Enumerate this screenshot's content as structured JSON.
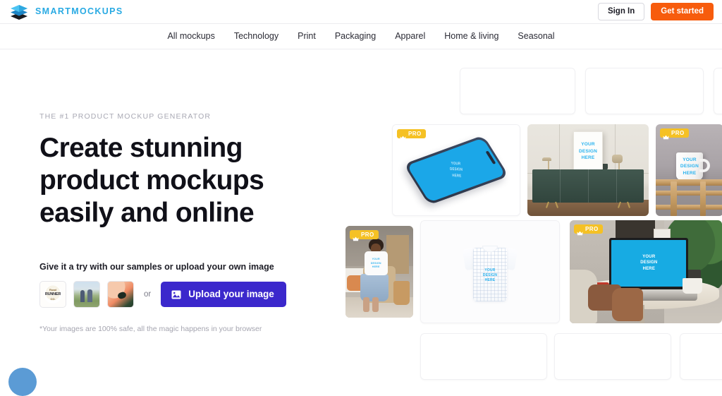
{
  "header": {
    "logo_icon": "layers-stack-icon",
    "brand_name": "SMARTMOCKUPS",
    "brand_color": "#29aae3",
    "sign_in_label": "Sign In",
    "get_started_label": "Get started",
    "get_started_color": "#f75c0d"
  },
  "nav": {
    "items": [
      {
        "label": "All mockups"
      },
      {
        "label": "Technology"
      },
      {
        "label": "Print"
      },
      {
        "label": "Packaging"
      },
      {
        "label": "Apparel"
      },
      {
        "label": "Home & living"
      },
      {
        "label": "Seasonal"
      }
    ]
  },
  "hero": {
    "eyebrow": "THE #1 PRODUCT MOCKUP GENERATOR",
    "headline": "Create stunning product mockups easily and online",
    "try_label": "Give it a try with our samples or upload your own image",
    "or_text": "or",
    "upload_label": "Upload your image",
    "upload_icon": "image-icon",
    "upload_color": "#3b28cc",
    "footnote": "*Your images are 100% safe, all the magic happens in your browser",
    "samples": [
      {
        "name": "sample-road-runner-logo",
        "alt_text_line1": "Road",
        "alt_text_line2": "RUNNER",
        "alt_text_line3": "CO."
      },
      {
        "name": "sample-people-outdoors"
      },
      {
        "name": "sample-abstract-art"
      }
    ]
  },
  "mockups": {
    "pro_badge_label": "PRO",
    "pro_badge_icon": "crown-icon",
    "pro_badge_color": "#f5c124",
    "design_placeholder": "YOUR\nDESIGN\nHERE",
    "cards": [
      {
        "name": "mockup-card-placeholder-top-1",
        "type": "placeholder",
        "pro": false
      },
      {
        "name": "mockup-card-placeholder-top-2",
        "type": "placeholder",
        "pro": false
      },
      {
        "name": "mockup-card-placeholder-top-3",
        "type": "placeholder",
        "pro": false
      },
      {
        "name": "mockup-card-phone",
        "type": "phone",
        "pro": true
      },
      {
        "name": "mockup-card-poster-sideboard",
        "type": "poster",
        "pro": false
      },
      {
        "name": "mockup-card-mug",
        "type": "mug",
        "pro": true
      },
      {
        "name": "mockup-card-person-tshirt",
        "type": "person",
        "pro": true
      },
      {
        "name": "mockup-card-flat-tshirt",
        "type": "tshirt",
        "pro": false
      },
      {
        "name": "mockup-card-laptop",
        "type": "laptop",
        "pro": true
      },
      {
        "name": "mockup-card-placeholder-bottom-1",
        "type": "placeholder",
        "pro": false
      },
      {
        "name": "mockup-card-placeholder-bottom-2",
        "type": "placeholder",
        "pro": false
      },
      {
        "name": "mockup-card-placeholder-bottom-3",
        "type": "placeholder",
        "pro": false
      }
    ]
  },
  "chat": {
    "icon": "chat-bubble-icon",
    "color": "#5b9bd5"
  }
}
